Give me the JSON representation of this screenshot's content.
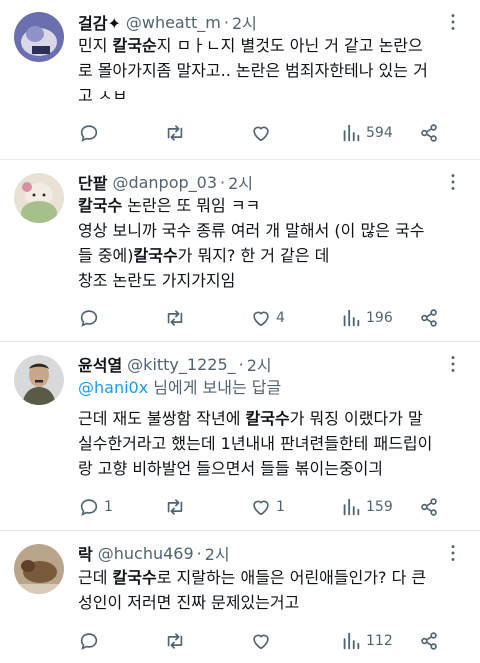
{
  "tweets": [
    {
      "name": "걸감✦",
      "handle": "@wheatt_m",
      "dot": "·",
      "time": "2시",
      "lines": [
        {
          "pre": "민지 ",
          "bold": "칼국순",
          "post": "지 ㅁㅏㄴ지 별것도 아닌 거 같고 논란으"
        },
        {
          "pre": "로 몰아가지좀 말자고.. 논란은 범죄자한테나 있는 거",
          "bold": "",
          "post": ""
        },
        {
          "pre": "고 ㅅㅂ",
          "bold": "",
          "post": ""
        }
      ],
      "reply_count": "",
      "retweet_count": "",
      "like_count": "",
      "view_count": "594"
    },
    {
      "name": "단팥",
      "handle": "@danpop_03",
      "dot": "·",
      "time": "2시",
      "lines": [
        {
          "pre": "",
          "bold": "칼국수",
          "post": " 논란은 또 뭐임 ㅋㅋ"
        },
        {
          "pre": "영상 보니까 국수 종류 여러 개 말해서 (이 많은 국수",
          "bold": "",
          "post": ""
        },
        {
          "pre": "들 중에)",
          "bold": "칼국수",
          "post": "가 뭐지? 한 거 같은 데"
        },
        {
          "pre": "창조 논란도 가지가지임",
          "bold": "",
          "post": ""
        }
      ],
      "reply_count": "",
      "retweet_count": "",
      "like_count": "4",
      "view_count": "196"
    },
    {
      "name": "윤석열",
      "handle": "@kitty_1225_",
      "dot": "·",
      "time": "2시",
      "reply_to": {
        "mention": "@hani0x",
        "suffix": " 님에게 보내는 답글"
      },
      "lines": [
        {
          "pre": "근데 재도 불쌍함 작년에 ",
          "bold": "칼국수",
          "post": "가 뭐징 이랬다가 말"
        },
        {
          "pre": "실수한거라고 했는데 1년내내 판녀련들한테 패드립이",
          "bold": "",
          "post": ""
        },
        {
          "pre": "랑 고향 비하발언 들으면서 들들 볶이는중이긔",
          "bold": "",
          "post": ""
        }
      ],
      "reply_count": "1",
      "retweet_count": "",
      "like_count": "1",
      "view_count": "159"
    },
    {
      "name": "락",
      "handle": "@huchu469",
      "dot": "·",
      "time": "2시",
      "lines": [
        {
          "pre": "근데 ",
          "bold": "칼국수",
          "post": "로 지랄하는 애들은 어린애들인가? 다 큰"
        },
        {
          "pre": "성인이 저러면 진짜 문제있는거고",
          "bold": "",
          "post": ""
        }
      ],
      "reply_count": "",
      "retweet_count": "",
      "like_count": "",
      "view_count": "112"
    }
  ],
  "colors": {
    "text": "#0f1419",
    "secondary": "#536471",
    "mention": "#1d9bf0",
    "divider": "#e7e9ea"
  },
  "icons": [
    "more-icon",
    "reply-icon",
    "retweet-icon",
    "like-icon",
    "views-icon",
    "share-icon"
  ]
}
